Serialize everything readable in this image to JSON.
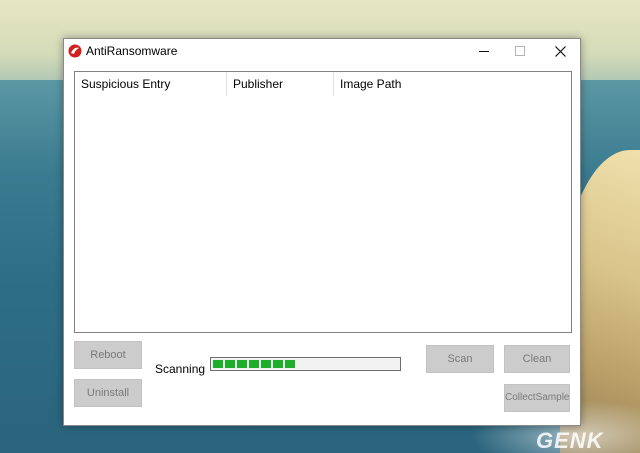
{
  "window": {
    "title": "AntiRansomware",
    "controls": {
      "minimize": "minimize",
      "maximize": "maximize",
      "close": "close"
    }
  },
  "list": {
    "columns": [
      "Suspicious Entry",
      "Publisher",
      "Image Path"
    ],
    "rows": []
  },
  "buttons": {
    "reboot": "Reboot",
    "uninstall": "Uninstall",
    "scan": "Scan",
    "clean": "Clean",
    "collect_sample": "CollectSample"
  },
  "status": {
    "label": "Scanning",
    "progress_segments": 7
  },
  "watermark": "GENK",
  "icons": {
    "app": "red-cross-logo-icon",
    "close": "close-icon"
  },
  "colors": {
    "progress": "#1fae2b",
    "button_disabled": "#cccccc"
  }
}
